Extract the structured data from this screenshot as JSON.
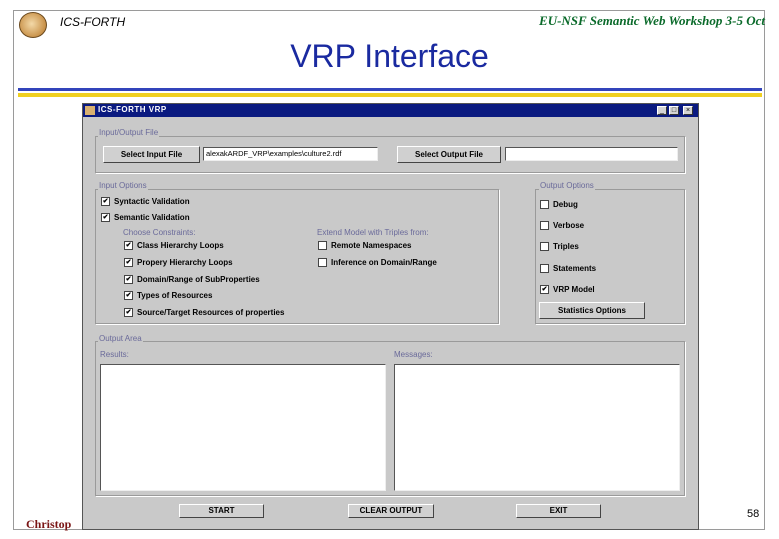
{
  "slide": {
    "org": "ICS-FORTH",
    "workshop": "EU-NSF Semantic Web Workshop 3-5 Oct",
    "title": "VRP Interface",
    "footer_name": "Christop",
    "page_number": "58",
    "colors": {
      "title": "#1a2aa0",
      "rule_blue": "#3344bb",
      "rule_yellow": "#f0d020",
      "workshop": "#0a6a2a"
    }
  },
  "window": {
    "title": "ICS-FORTH VRP",
    "controls": {
      "minimize": "_",
      "maximize": "□",
      "close": "×"
    },
    "io_file": {
      "label": "Input/Output File",
      "select_input_label": "Select Input File",
      "input_path": "alexakARDF_VRP\\examples\\culture2.rdf",
      "select_output_label": "Select Output File",
      "output_path": ""
    },
    "input_options": {
      "label": "Input Options",
      "syntactic": {
        "label": "Syntactic Validation",
        "checked": true
      },
      "semantic": {
        "label": "Semantic Validation",
        "checked": true
      },
      "choose_constraints_label": "Choose Constraints:",
      "constraints": [
        {
          "label": "Class Hierarchy Loops",
          "checked": true
        },
        {
          "label": "Propery Hierarchy Loops",
          "checked": true
        },
        {
          "label": "Domain/Range of SubProperties",
          "checked": true
        },
        {
          "label": "Types of Resources",
          "checked": true
        },
        {
          "label": "Source/Target Resources of properties",
          "checked": true
        }
      ],
      "extend_label": "Extend Model with Triples from:",
      "extend": [
        {
          "label": "Remote Namespaces",
          "checked": false
        },
        {
          "label": "Inference on Domain/Range",
          "checked": false
        }
      ]
    },
    "output_options": {
      "label": "Output Options",
      "items": [
        {
          "label": "Debug",
          "checked": false
        },
        {
          "label": "Verbose",
          "checked": false
        },
        {
          "label": "Triples",
          "checked": false
        },
        {
          "label": "Statements",
          "checked": false
        },
        {
          "label": "VRP Model",
          "checked": true
        }
      ],
      "statistics_button": "Statistics Options"
    },
    "output_area": {
      "label": "Output Area",
      "results_label": "Results:",
      "messages_label": "Messages:"
    },
    "buttons": {
      "start": "START",
      "clear": "CLEAR OUTPUT",
      "exit": "EXIT"
    }
  }
}
